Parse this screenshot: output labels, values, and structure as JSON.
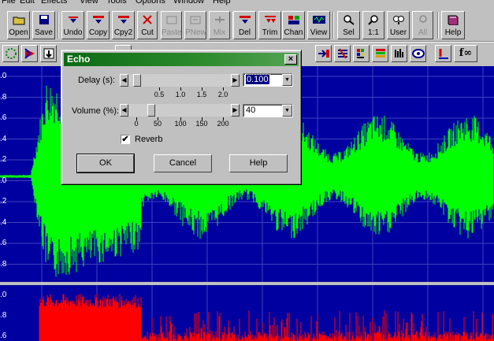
{
  "menu": [
    "File",
    "Edit",
    "Effects",
    "View",
    "Tools",
    "Options",
    "Window",
    "Help"
  ],
  "toolbar": [
    {
      "label": "Open",
      "icon": "open-icon",
      "enabled": true
    },
    {
      "label": "Save",
      "icon": "save-icon",
      "enabled": true
    },
    {
      "label": "Undo",
      "icon": "undo-icon",
      "enabled": true
    },
    {
      "label": "Copy",
      "icon": "copy-icon",
      "enabled": true
    },
    {
      "label": "Cpy2",
      "icon": "copy2-icon",
      "enabled": true
    },
    {
      "label": "Cut",
      "icon": "cut-icon",
      "enabled": true
    },
    {
      "label": "Paste",
      "icon": "paste-icon",
      "enabled": false
    },
    {
      "label": "PNew",
      "icon": "paste-new-icon",
      "enabled": false
    },
    {
      "label": "Mix",
      "icon": "mix-icon",
      "enabled": false
    },
    {
      "label": "Del",
      "icon": "delete-icon",
      "enabled": true
    },
    {
      "label": "Trim",
      "icon": "trim-icon",
      "enabled": true
    },
    {
      "label": "Chan",
      "icon": "channel-icon",
      "enabled": true
    },
    {
      "label": "View",
      "icon": "view-icon",
      "enabled": true
    },
    {
      "label": "Sel",
      "icon": "zoom-selection-icon",
      "enabled": true
    },
    {
      "label": "1:1",
      "icon": "zoom-1to1-icon",
      "enabled": true
    },
    {
      "label": "User",
      "icon": "zoom-user-icon",
      "enabled": true
    },
    {
      "label": "All",
      "icon": "zoom-all-icon",
      "enabled": false
    },
    {
      "label": "Help",
      "icon": "help-book-icon",
      "enabled": true
    }
  ],
  "waveform": {
    "y_labels_top": [
      ".0",
      ".8",
      ".6",
      ".4",
      ".2",
      ".0",
      ".2",
      ".4",
      ".6",
      ".8"
    ],
    "y_labels_bottom": [
      ".0",
      ".8",
      ".6"
    ],
    "colors": {
      "background": "#0000a0",
      "grid": "#4040c0",
      "channel1": "#00ff00",
      "channel2": "#ff0000"
    }
  },
  "dialog": {
    "title": "Echo",
    "close_label": "×",
    "delay": {
      "label": "Delay (s):",
      "value": "0.100",
      "level": 0.05,
      "ticks": [
        "0.5",
        "1.0",
        "1.5",
        "2.0"
      ]
    },
    "volume": {
      "label": "Volume (%):",
      "value": "40",
      "level": 0.2,
      "ticks": [
        "0",
        "50",
        "100",
        "150",
        "200"
      ]
    },
    "reverb": {
      "label": "Reverb",
      "checked": true,
      "check_mark": "✔"
    },
    "buttons": {
      "ok": "OK",
      "cancel": "Cancel",
      "help": "Help"
    }
  }
}
